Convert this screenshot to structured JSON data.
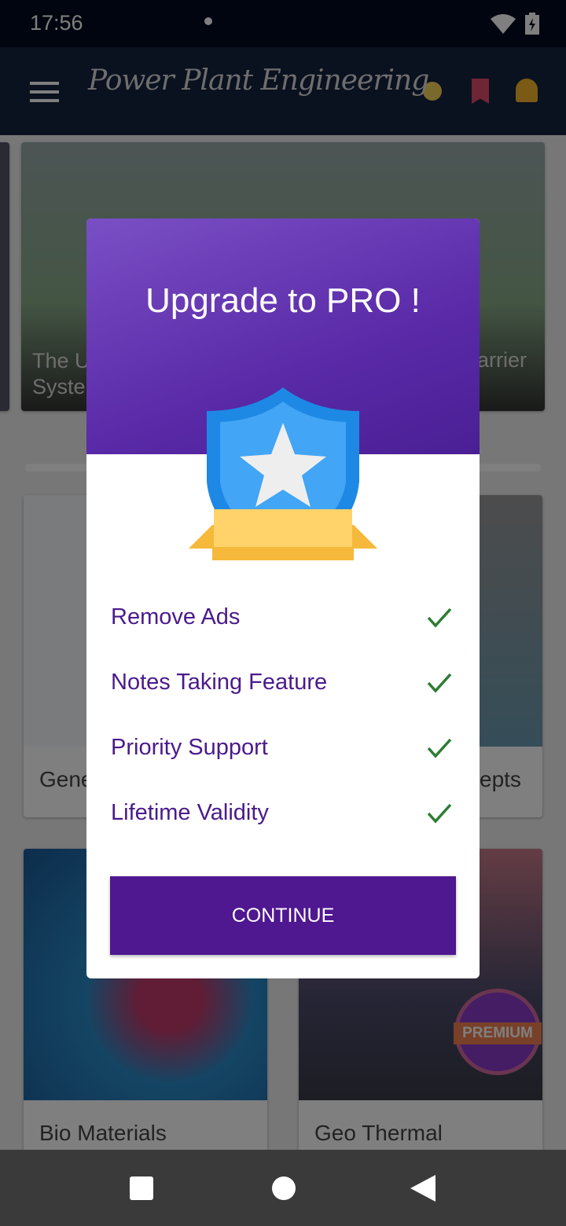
{
  "status": {
    "time": "17:56"
  },
  "appbar": {
    "title": "Power Plant Engineering"
  },
  "carousel": {
    "left_caption": "The U\nSyste",
    "right_caption": "arrier"
  },
  "cards": [
    {
      "label": "Gene"
    },
    {
      "label": "epts"
    },
    {
      "label": "Bio Materials"
    },
    {
      "label": "Geo Thermal"
    }
  ],
  "premium_badge": "PREMIUM",
  "dialog": {
    "title": "Upgrade to PRO !",
    "features": [
      "Remove Ads",
      "Notes Taking Feature",
      "Priority Support",
      "Lifetime Validity"
    ],
    "continue_label": "CONTINUE"
  },
  "colors": {
    "accent": "#4f1790",
    "check": "#2e7d32",
    "feature_text": "#4a1a8c"
  }
}
